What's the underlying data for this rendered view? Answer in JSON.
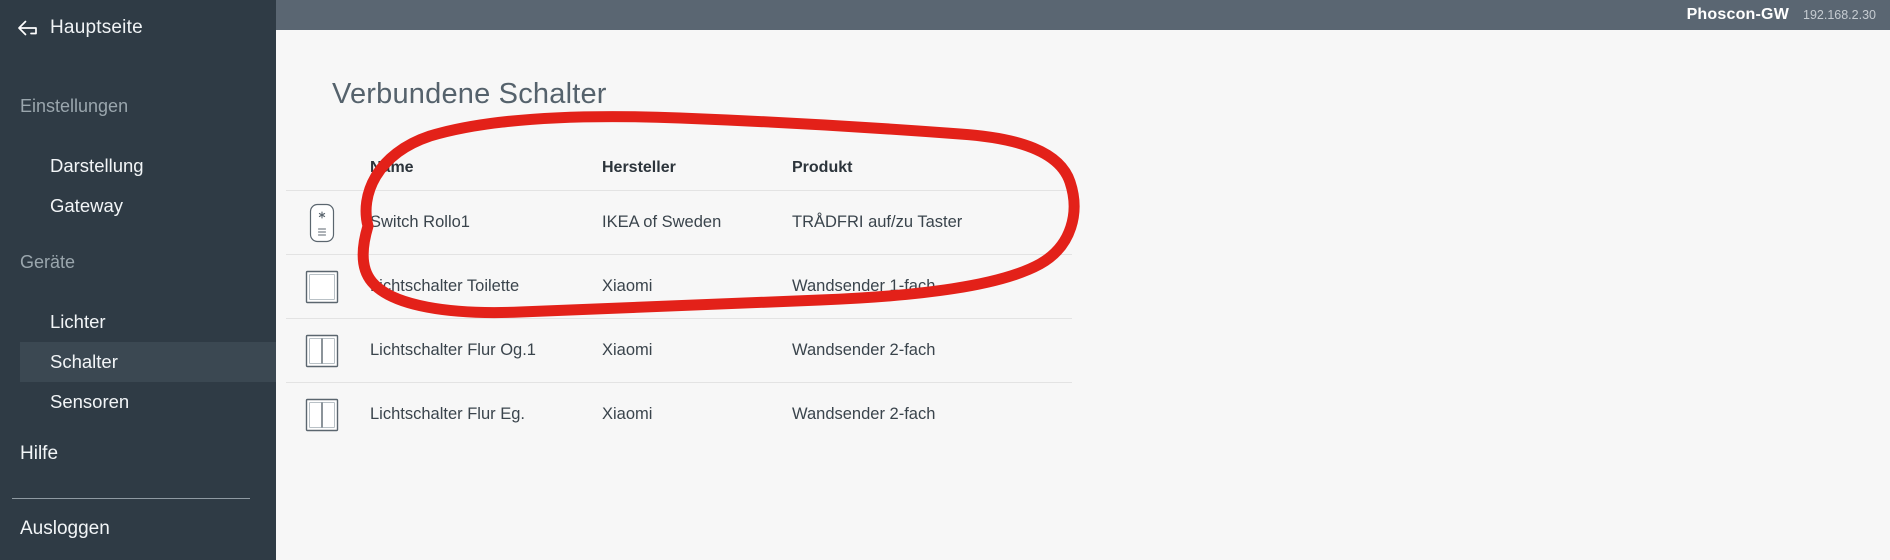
{
  "sidebar": {
    "home": {
      "label": "Hauptseite",
      "icon": "back-arrow-icon"
    },
    "groups": [
      {
        "title": "Einstellungen",
        "items": [
          {
            "label": "Darstellung",
            "active": false
          },
          {
            "label": "Gateway",
            "active": false
          }
        ]
      },
      {
        "title": "Geräte",
        "items": [
          {
            "label": "Lichter",
            "active": false
          },
          {
            "label": "Schalter",
            "active": true
          },
          {
            "label": "Sensoren",
            "active": false
          }
        ]
      }
    ],
    "help": "Hilfe",
    "logout": "Ausloggen",
    "background": "#2f3b45",
    "active_background": "#3b4852"
  },
  "topbar": {
    "gateway_name": "Phoscon-GW",
    "ip_address": "192.168.2.30",
    "background": "#5a6672"
  },
  "main": {
    "page_title": "Verbundene Schalter",
    "table": {
      "columns": [
        "",
        "Name",
        "Hersteller",
        "Produkt"
      ],
      "rows": [
        {
          "icon": "ikea-trabfri-remote-icon",
          "name": "Switch Rollo1",
          "manufacturer": "IKEA of Sweden",
          "product": "TRÅDFRI auf/zu Taster"
        },
        {
          "icon": "wall-switch-1gang-icon",
          "name": "Lichtschalter Toilette",
          "manufacturer": "Xiaomi",
          "product": "Wandsender 1-fach"
        },
        {
          "icon": "wall-switch-2gang-icon",
          "name": "Lichtschalter Flur Og.1",
          "manufacturer": "Xiaomi",
          "product": "Wandsender 2-fach"
        },
        {
          "icon": "wall-switch-2gang-icon",
          "name": "Lichtschalter Flur Eg.",
          "manufacturer": "Xiaomi",
          "product": "Wandsender 2-fach"
        }
      ]
    }
  },
  "annotation": {
    "type": "hand-drawn-ellipse",
    "color": "#e32119",
    "encircles": "header row and first device row"
  }
}
